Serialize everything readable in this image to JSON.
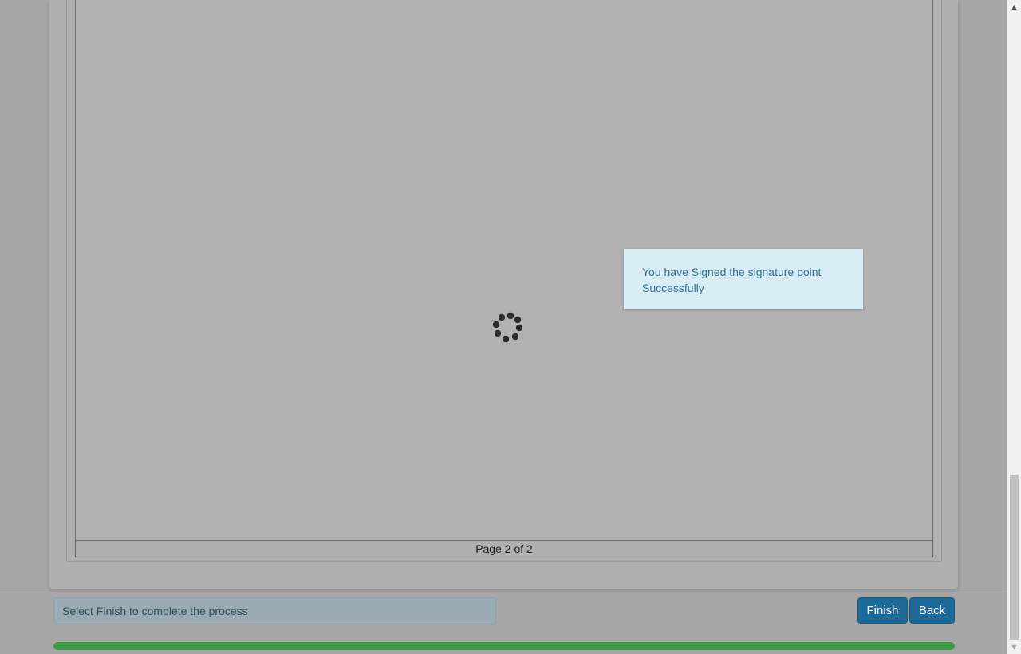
{
  "viewer": {
    "page_indicator": "Page 2 of 2"
  },
  "notification": {
    "message": "You have Signed the signature point Successfully"
  },
  "footer": {
    "status_text": "Select Finish to complete the process",
    "finish_label": "Finish",
    "back_label": "Back"
  },
  "progress": {
    "value_percent": 100,
    "color": "#3f9a45"
  },
  "scrollbar": {
    "up_icon": "▲",
    "down_icon": "▼"
  },
  "colors": {
    "button": "#1d6a9a",
    "toast_bg": "#d9edf7",
    "toast_text": "#31708f"
  }
}
